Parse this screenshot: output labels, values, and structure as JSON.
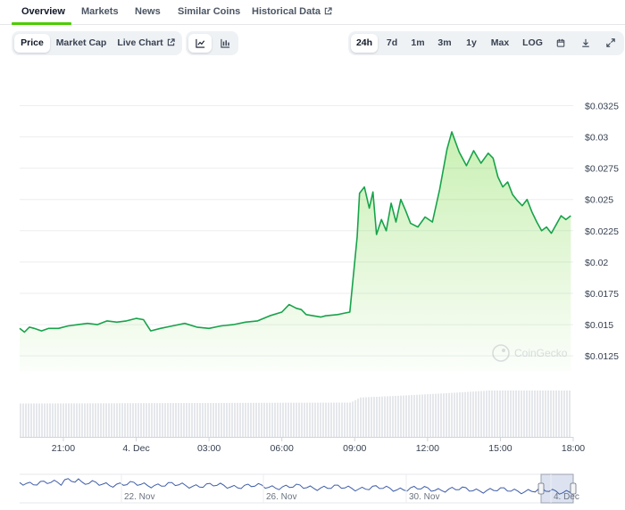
{
  "tabs": [
    {
      "label": "Overview",
      "active": true
    },
    {
      "label": "Markets"
    },
    {
      "label": "News"
    },
    {
      "label": "Similar Coins"
    },
    {
      "label": "Historical Data",
      "external": true
    }
  ],
  "toolbar": {
    "metric": [
      "Price",
      "Market Cap",
      "Live Chart"
    ],
    "metric_active": "Price",
    "chart_style_icons": [
      "line-chart-icon",
      "candlestick-icon"
    ],
    "ranges": [
      "24h",
      "7d",
      "1m",
      "3m",
      "1y",
      "Max",
      "LOG"
    ],
    "range_active": "24h",
    "extra_icons": [
      "calendar-icon",
      "download-icon",
      "expand-icon"
    ]
  },
  "watermark": "CoinGecko",
  "colors": {
    "line": "#17a34a",
    "fill": "#4bcc00",
    "volume": "#e5e7eb",
    "active_tab": "#4bcc00",
    "navigator": "#3f5ea8"
  },
  "chart_data": {
    "type": "area",
    "y_ticks": [
      "$0.0325",
      "$0.03",
      "$0.0275",
      "$0.025",
      "$0.0225",
      "$0.02",
      "$0.0175",
      "$0.015",
      "$0.0125"
    ],
    "x_ticks": [
      "21:00",
      "4. Dec",
      "03:00",
      "06:00",
      "09:00",
      "12:00",
      "15:00",
      "18:00"
    ],
    "ylim": [
      0.0113,
      0.0341
    ],
    "xlim": [
      -1.8,
      21.0
    ],
    "series": [
      {
        "type": "line",
        "x": [
          -1.8,
          -1.6,
          -1.4,
          -1.2,
          -0.9,
          -0.6,
          -0.2,
          0.2,
          0.6,
          1.0,
          1.4,
          1.8,
          2.2,
          2.6,
          3.0,
          3.3,
          3.5,
          3.6,
          4.0,
          4.5,
          5.0,
          5.5,
          6.0,
          6.5,
          7.0,
          7.5,
          8.0,
          8.5,
          9.0,
          9.3,
          9.6,
          9.8,
          10.0,
          10.3,
          10.6,
          10.8,
          11.3,
          11.8,
          12.1,
          12.2,
          12.4,
          12.6,
          12.75,
          12.9,
          13.1,
          13.3,
          13.5,
          13.7,
          13.9,
          14.1,
          14.3,
          14.6,
          14.9,
          15.2,
          15.5,
          15.8,
          16.0,
          16.3,
          16.6,
          16.9,
          17.2,
          17.5,
          17.7,
          17.9,
          18.1,
          18.3,
          18.5,
          18.7,
          18.9,
          19.1,
          19.3,
          19.5,
          19.7,
          19.9,
          20.1,
          20.3,
          20.5,
          20.7,
          20.9
        ],
        "y": [
          0.0147,
          0.0144,
          0.0148,
          0.0147,
          0.0145,
          0.0147,
          0.0147,
          0.0149,
          0.015,
          0.0151,
          0.015,
          0.0153,
          0.0152,
          0.0153,
          0.0155,
          0.0154,
          0.0148,
          0.0145,
          0.0147,
          0.0149,
          0.0151,
          0.0148,
          0.0147,
          0.0149,
          0.015,
          0.0152,
          0.0153,
          0.0157,
          0.016,
          0.0166,
          0.0163,
          0.0162,
          0.0158,
          0.0157,
          0.0156,
          0.0157,
          0.0158,
          0.016,
          0.022,
          0.0255,
          0.026,
          0.0243,
          0.0256,
          0.0222,
          0.0234,
          0.0225,
          0.0247,
          0.0232,
          0.025,
          0.0241,
          0.0231,
          0.0228,
          0.0236,
          0.0232,
          0.0258,
          0.029,
          0.0304,
          0.0288,
          0.0277,
          0.0289,
          0.0279,
          0.0287,
          0.0283,
          0.0268,
          0.026,
          0.0264,
          0.0254,
          0.0249,
          0.0245,
          0.025,
          0.024,
          0.0232,
          0.0225,
          0.0228,
          0.0223,
          0.023,
          0.0237,
          0.0234,
          0.0237
        ]
      }
    ],
    "volume": {
      "x_start": -1.8,
      "x_end": 20.9,
      "levels": [
        {
          "x": -1.8,
          "v": 0.72
        },
        {
          "x": 11.8,
          "v": 0.74
        },
        {
          "x": 12.2,
          "v": 0.85
        },
        {
          "x": 13.5,
          "v": 0.88
        },
        {
          "x": 16.0,
          "v": 0.95
        },
        {
          "x": 17.5,
          "v": 1.0
        },
        {
          "x": 20.9,
          "v": 1.0
        }
      ]
    },
    "navigator": {
      "labels": [
        "22. Nov",
        "26. Nov",
        "30. Nov",
        "4. Dec"
      ]
    }
  }
}
